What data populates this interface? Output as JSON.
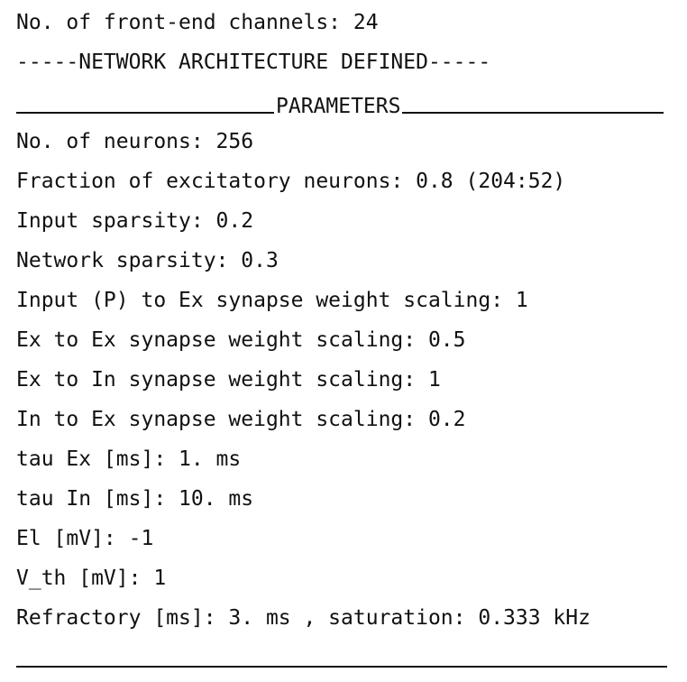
{
  "header": {
    "channels": "No. of front-end channels: 24",
    "architecture": "-----NETWORK ARCHITECTURE DEFINED-----",
    "parameters_title": "PARAMETERS"
  },
  "params": [
    "No. of neurons: 256",
    "Fraction of excitatory neurons: 0.8 (204:52)",
    "Input sparsity: 0.2",
    "Network sparsity: 0.3",
    "Input (P) to Ex synapse weight scaling: 1",
    "Ex to Ex synapse weight scaling: 0.5",
    "Ex to In synapse weight scaling: 1",
    "In to Ex synapse weight scaling: 0.2",
    "tau Ex [ms]: 1. ms",
    "tau In [ms]: 10. ms",
    "El [mV]: -1",
    "V_th [mV]: 1",
    "Refractory [ms]: 3. ms , saturation: 0.333 kHz"
  ]
}
